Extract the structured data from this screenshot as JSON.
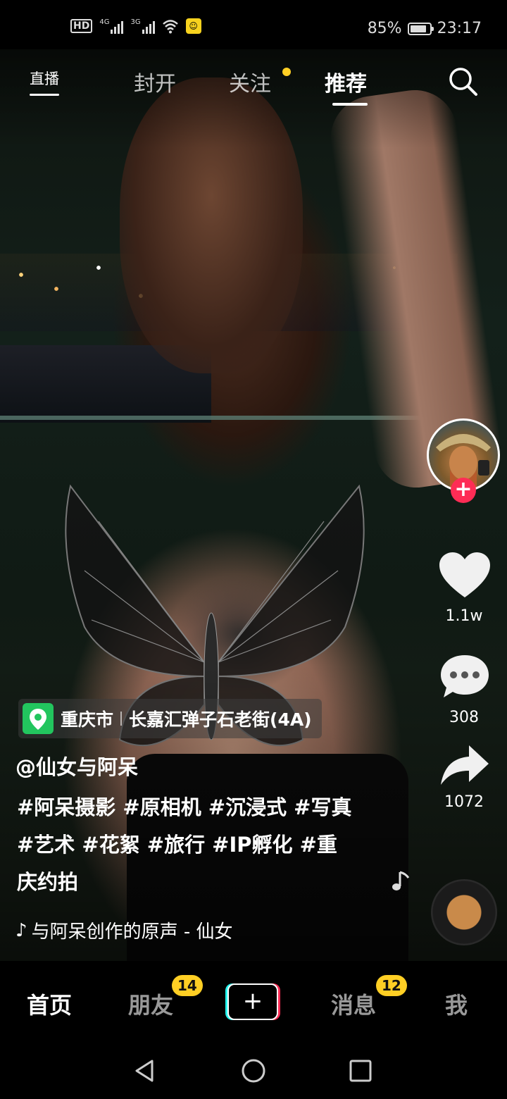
{
  "status_bar": {
    "hd": "HD",
    "net1": "4G",
    "net2": "3G",
    "battery_percent": "85%",
    "battery_level": 0.85,
    "time": "23:17"
  },
  "top_nav": {
    "live_label": "直播",
    "tabs": [
      {
        "label": "封开",
        "active": false
      },
      {
        "label": "关注",
        "active": false,
        "dot": true
      },
      {
        "label": "推荐",
        "active": true
      }
    ],
    "dot_color": "#ffcf24"
  },
  "right_rail": {
    "follow_label": "+",
    "likes": "1.1w",
    "comments": "308",
    "shares": "1072"
  },
  "video_info": {
    "location": {
      "city": "重庆市",
      "place": "长嘉汇弹子石老街(4A)"
    },
    "author": "@仙女与阿呆",
    "caption": "#阿呆摄影 #原相机 #沉浸式 #写真 #艺术 #花絮 #旅行 #IP孵化 #重庆约拍",
    "music": "与阿呆创作的原声 - 仙女"
  },
  "bottom_nav": {
    "items": [
      {
        "label": "首页",
        "active": true
      },
      {
        "label": "朋友",
        "badge": "14"
      },
      {
        "label": "+"
      },
      {
        "label": "消息",
        "badge": "12"
      },
      {
        "label": "我"
      }
    ]
  },
  "colors": {
    "accent_red": "#fe2c55",
    "accent_cyan": "#25f4ee",
    "badge_yellow": "#ffcf24",
    "location_green": "#22c55e"
  }
}
